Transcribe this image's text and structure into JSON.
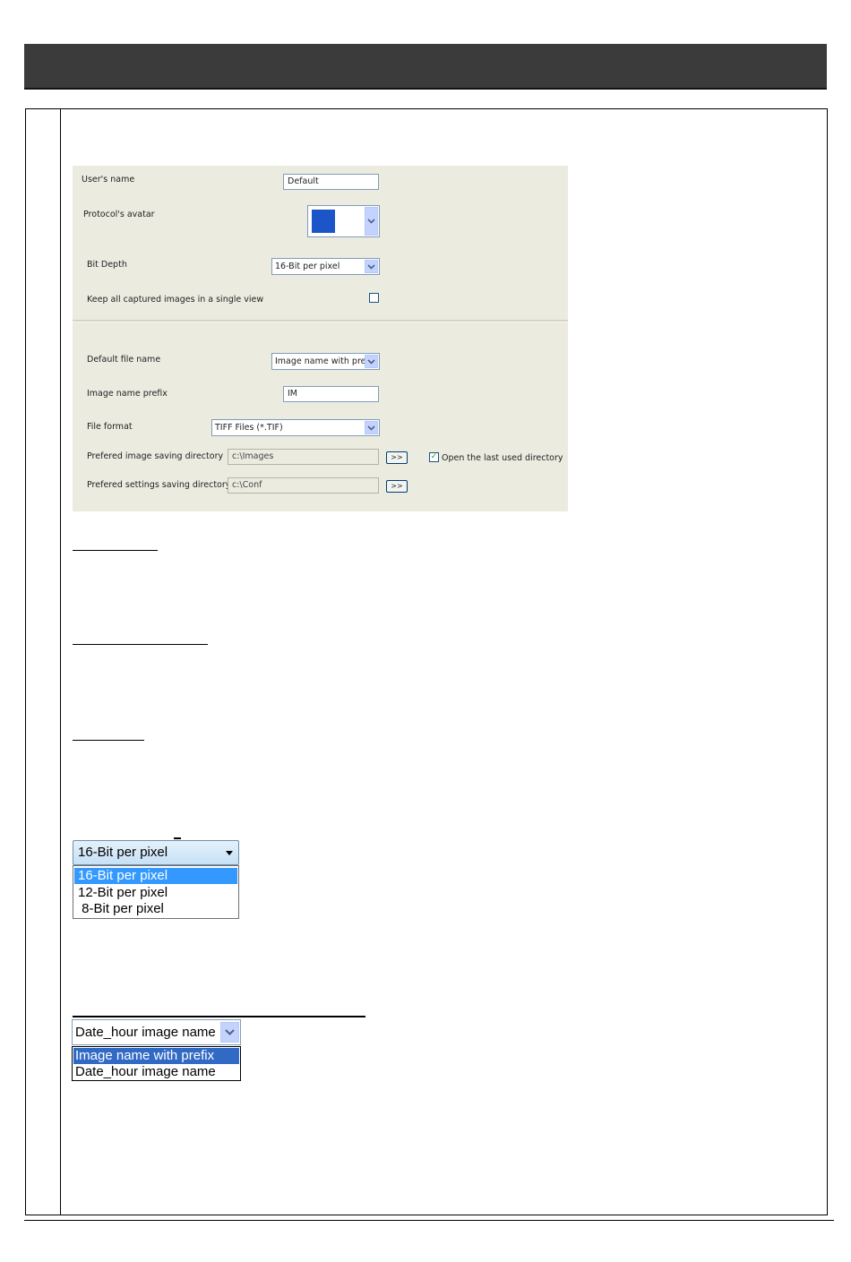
{
  "settings_panel": {
    "users_name_label": "User's name",
    "users_name_value": "Default",
    "avatar_label": "Protocol's avatar",
    "avatar_color": "#1b55c7",
    "bit_depth_label": "Bit Depth",
    "bit_depth_value": "16-Bit per pixel",
    "keep_images_label": "Keep all captured images in a single view",
    "keep_images_checked": false,
    "default_file_name_label": "Default file name",
    "default_file_name_value": "Image name with prefix",
    "image_prefix_label": "Image name prefix",
    "image_prefix_value": "IM",
    "file_format_label": "File format",
    "file_format_value": "TIFF Files (*.TIF)",
    "image_dir_label": "Prefered image saving directory",
    "image_dir_value": "c:\\Images",
    "browse_label": ">>",
    "open_last_dir_label": "Open the last used directory",
    "open_last_dir_checked": true,
    "open_last_dir_mark": "✓",
    "settings_dir_label": "Prefered settings saving directory",
    "settings_dir_value": "c:\\Conf"
  },
  "bit_depth_dropdown": {
    "selected": "16-Bit per pixel",
    "options": [
      "16-Bit per pixel",
      "12-Bit per pixel",
      " 8-Bit per pixel"
    ]
  },
  "file_name_dropdown": {
    "selected": "Date_hour image name",
    "options": [
      "Image name with prefix",
      "Date_hour image name"
    ]
  }
}
